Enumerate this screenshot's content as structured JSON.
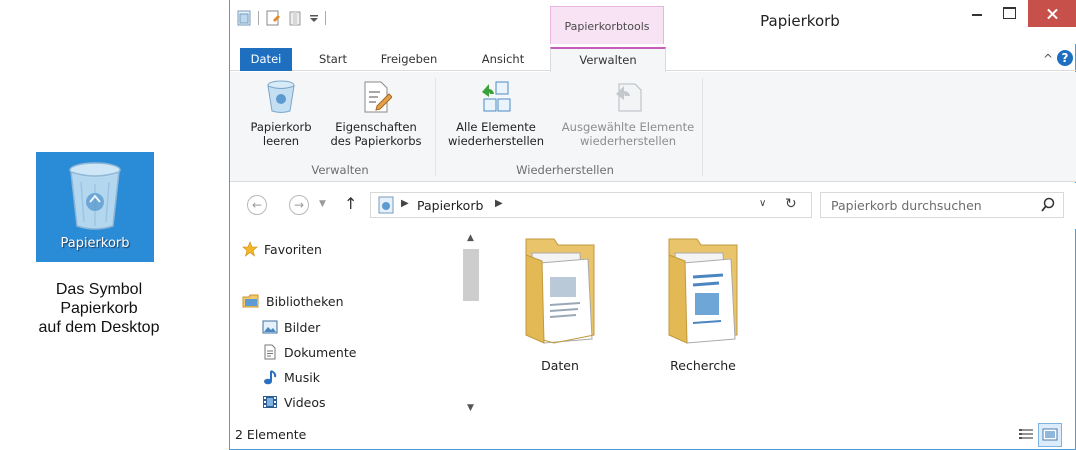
{
  "desktop": {
    "icon_label": "Papierkorb",
    "caption_lines": [
      "Das Symbol",
      "Papierkorb",
      "auf dem Desktop"
    ]
  },
  "window": {
    "title": "Papierkorb",
    "contextual_tab_group": "Papierkorbtools"
  },
  "ribbon_tabs": [
    "Datei",
    "Start",
    "Freigeben",
    "Ansicht",
    "Verwalten"
  ],
  "ribbon": {
    "buttons": [
      {
        "line1": "Papierkorb",
        "line2": "leeren"
      },
      {
        "line1": "Eigenschaften",
        "line2": "des Papierkorbs"
      },
      {
        "line1": "Alle Elemente",
        "line2": "wiederherstellen"
      },
      {
        "line1": "Ausgewählte Elemente",
        "line2": "wiederherstellen"
      }
    ],
    "groups": [
      "Verwalten",
      "Wiederherstellen"
    ]
  },
  "address": {
    "crumb": "Papierkorb",
    "search_placeholder": "Papierkorb durchsuchen"
  },
  "nav": {
    "favorites": "Favoriten",
    "libraries": "Bibliotheken",
    "items": [
      "Bilder",
      "Dokumente",
      "Musik",
      "Videos"
    ]
  },
  "content": {
    "folders": [
      "Daten",
      "Recherche"
    ]
  },
  "status": {
    "count": "2 Elemente"
  },
  "colors": {
    "accent_blue": "#1e6fc0",
    "close_red": "#c7504a",
    "tools_pink": "#f7e3f4",
    "desktop_blue": "#2a8bd6"
  }
}
